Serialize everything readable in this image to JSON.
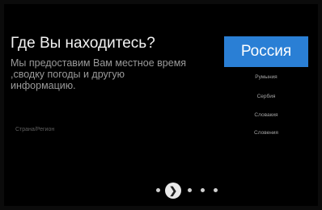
{
  "setup": {
    "title": "Где Вы находитесь?",
    "description": "Мы предоставим Вам местное время ,сводку погоды и другую информацию.",
    "region_label": "Страна/Регион"
  },
  "countries": {
    "selected": "Россия",
    "items": [
      "Румыния",
      "Сербия",
      "Словакия",
      "Словения"
    ]
  },
  "pager": {
    "total": 5,
    "current": 2,
    "current_icon": "chevron-right-icon"
  },
  "colors": {
    "accent": "#2a7fd5",
    "background": "#000000"
  }
}
